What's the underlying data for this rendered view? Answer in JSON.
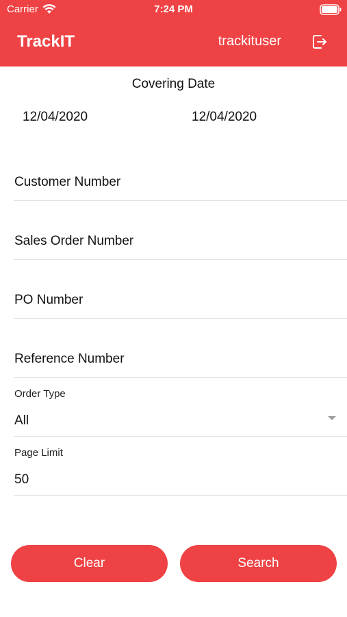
{
  "status_bar": {
    "carrier": "Carrier",
    "time": "7:24 PM"
  },
  "header": {
    "app_title": "TrackIT",
    "username": "trackituser"
  },
  "form": {
    "covering_date_label": "Covering Date",
    "date_from": "12/04/2020",
    "date_to": "12/04/2020",
    "customer_number_placeholder": "Customer Number",
    "sales_order_number_placeholder": "Sales Order Number",
    "po_number_placeholder": "PO Number",
    "reference_number_placeholder": "Reference Number",
    "order_type_label": "Order Type",
    "order_type_value": "All",
    "page_limit_label": "Page Limit",
    "page_limit_value": "50"
  },
  "buttons": {
    "clear": "Clear",
    "search": "Search"
  },
  "colors": {
    "brand": "#ef4244",
    "divider": "#e2e2e2",
    "text": "#111111"
  },
  "icons": [
    "wifi-icon",
    "battery-icon",
    "logout-icon",
    "chevron-down-icon"
  ]
}
